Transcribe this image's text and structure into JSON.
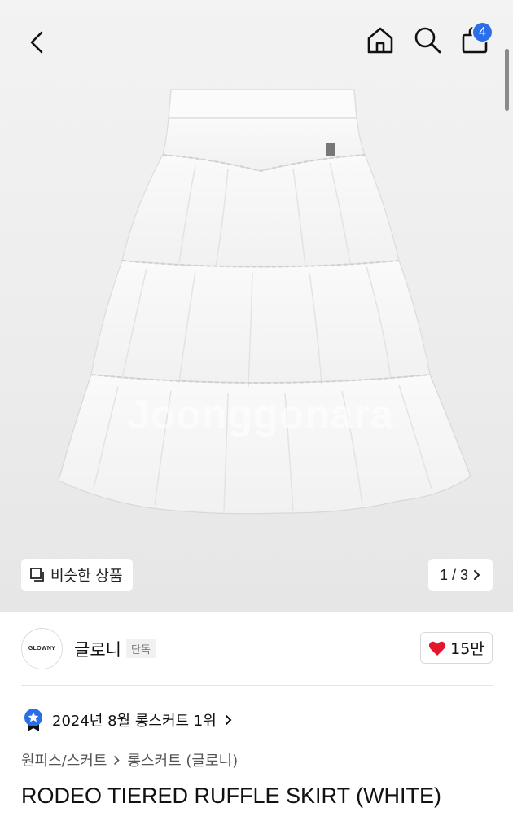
{
  "header": {
    "icons": [
      "back-icon",
      "home-icon",
      "search-icon",
      "shopping-bag-icon"
    ],
    "cart_count": "4"
  },
  "hero": {
    "watermark": "Joonggonara",
    "similar_label": "비슷한 상품",
    "pager_label": "1 / 3",
    "colors": {
      "background": "#eeeeee",
      "badge": "#2a6fe8"
    }
  },
  "brand": {
    "logo_text": "GLOWNY",
    "name": "글로니",
    "tag": "단독",
    "likes": "15만",
    "heart_color": "#e5152b"
  },
  "ranking": {
    "text": "2024년 8월 롱스커트 1위"
  },
  "breadcrumb": {
    "first": "원피스/스커트",
    "second": "롱스커트 (글로니)"
  },
  "product": {
    "title": "RODEO TIERED RUFFLE SKIRT (WHITE)"
  }
}
